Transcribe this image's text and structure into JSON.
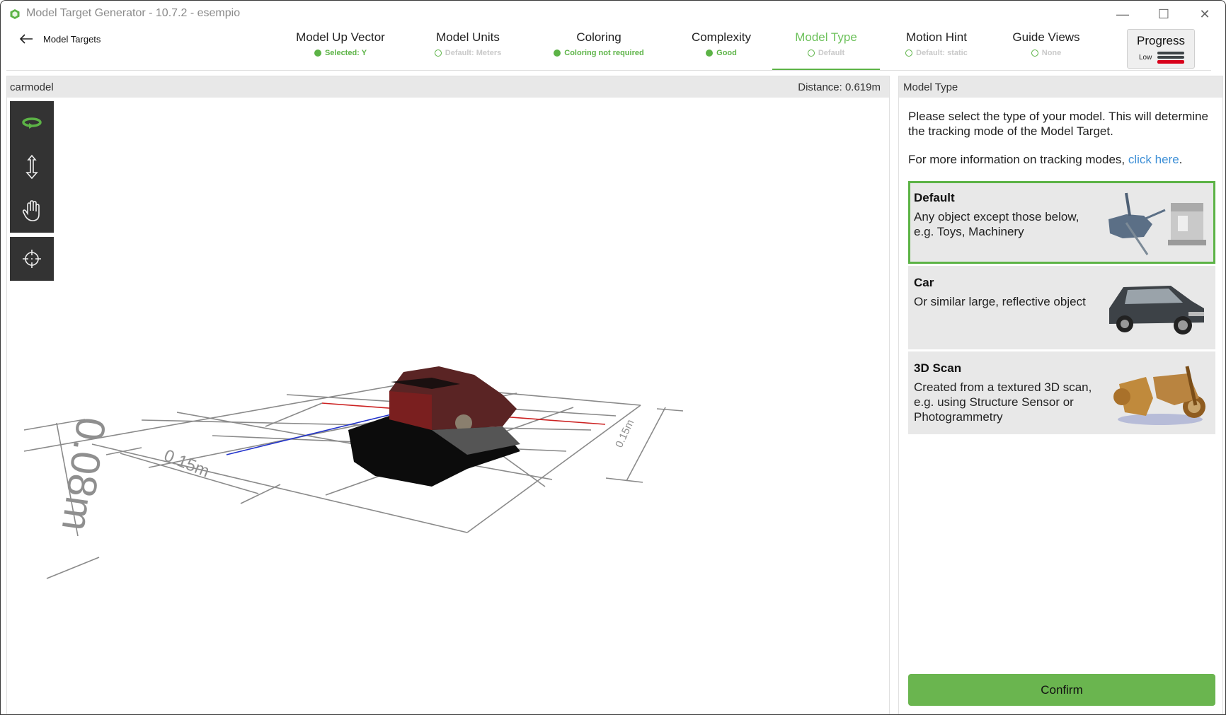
{
  "window": {
    "title": "Model Target Generator - 10.7.2 - esempio",
    "controls": {
      "minimize": "—",
      "maximize": "☐",
      "close": "✕"
    }
  },
  "back": {
    "label": "Model Targets"
  },
  "nav": {
    "tabs": [
      {
        "label": "Model Up Vector",
        "status": "Selected: Y",
        "state": "done"
      },
      {
        "label": "Model Units",
        "status": "Default: Meters",
        "state": "pending"
      },
      {
        "label": "Coloring",
        "status": "Coloring not required",
        "state": "done"
      },
      {
        "label": "Complexity",
        "status": "Good",
        "state": "done"
      },
      {
        "label": "Model Type",
        "status": "Default",
        "state": "active"
      },
      {
        "label": "Motion Hint",
        "status": "Default: static",
        "state": "pending"
      },
      {
        "label": "Guide Views",
        "status": "None",
        "state": "pending"
      }
    ],
    "progress": {
      "label": "Progress",
      "level": "Low",
      "bars_filled": 1,
      "bars_total": 3
    }
  },
  "viewport": {
    "model_name": "carmodel",
    "distance": "Distance:  0.619m",
    "tools": [
      {
        "name": "orbit",
        "active": true
      },
      {
        "name": "zoom"
      },
      {
        "name": "pan"
      },
      {
        "name": "center"
      }
    ],
    "dimensions": {
      "height": "0.08m",
      "width": "0.15m",
      "depth": "0.15m"
    }
  },
  "side": {
    "title": "Model Type",
    "description": "Please select the type of your model. This will determine the tracking mode of the Model Target.",
    "info_prefix": "For more information on tracking modes, ",
    "info_link": "click here",
    "info_suffix": ".",
    "options": [
      {
        "title": "Default",
        "description": "Any object except those below, e.g. Toys, Machinery",
        "selected": true
      },
      {
        "title": "Car",
        "description": "Or similar large, reflective object",
        "selected": false
      },
      {
        "title": "3D Scan",
        "description": "Created from a textured 3D scan, e.g. using Structure Sensor or Photogrammetry",
        "selected": false
      }
    ],
    "confirm_label": "Confirm"
  },
  "colors": {
    "accent": "#5cb346",
    "confirm": "#6ab54f",
    "link": "#3d8fd6",
    "toolbar": "#333333",
    "progress_low": "#d8001a"
  }
}
